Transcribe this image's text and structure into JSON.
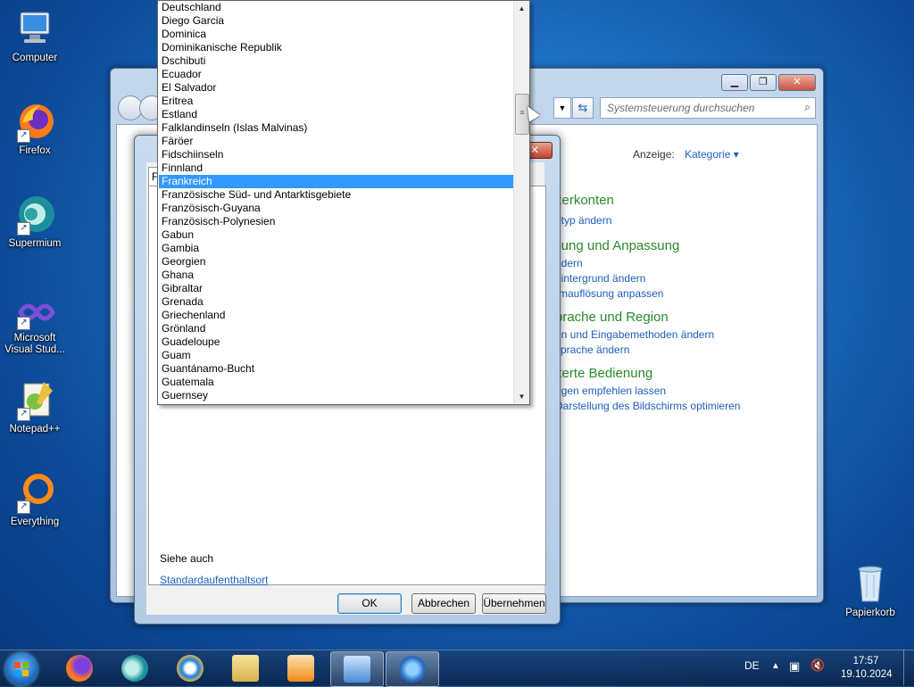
{
  "desktop": {
    "icons": [
      {
        "label": "Computer",
        "icon": "computer-icon"
      },
      {
        "label": "Firefox",
        "icon": "firefox-icon"
      },
      {
        "label": "Supermium",
        "icon": "supermium-icon"
      },
      {
        "label": "Microsoft Visual Stud...",
        "icon": "visual-studio-icon"
      },
      {
        "label": "Notepad++",
        "icon": "notepad-plus-icon"
      },
      {
        "label": "Everything",
        "icon": "everything-icon"
      },
      {
        "label": "Papierkorb",
        "icon": "recycle-bin-icon"
      }
    ]
  },
  "control_panel": {
    "search_placeholder": "Systemsteuerung durchsuchen",
    "view_label": "Anzeige:",
    "view_value": "Kategorie",
    "categories": [
      {
        "title": "zerkonten",
        "links": [
          "ptyp ändern"
        ]
      },
      {
        "title": "llung und Anpassung",
        "links": [
          "ndern",
          "hintergrund ändern",
          "rmauflösung anpassen"
        ]
      },
      {
        "title": "prache und Region",
        "links": [
          "en und Eingabemethoden ändern",
          "sprache ändern"
        ]
      },
      {
        "title": "iterte Bedienung",
        "links": [
          "ngen empfehlen lassen",
          "Darstellung des Bildschirms optimieren"
        ]
      }
    ]
  },
  "dialog": {
    "tab_label": "F",
    "see_also": "Siehe auch",
    "default_location_link": "Standardaufenthaltsort",
    "ok": "OK",
    "cancel": "Abbrechen",
    "apply": "Übernehmen"
  },
  "dropdown": {
    "items": [
      "Deutschland",
      "Diego Garcia",
      "Dominica",
      "Dominikanische Republik",
      "Dschibuti",
      "Ecuador",
      "El Salvador",
      "Eritrea",
      "Estland",
      "Falklandinseln (Islas Malvinas)",
      "Färöer",
      "Fidschiinseln",
      "Finnland",
      "Frankreich",
      "Französische Süd- und Antarktisgebiete",
      "Französisch-Guyana",
      "Französisch-Polynesien",
      "Gabun",
      "Gambia",
      "Georgien",
      "Ghana",
      "Gibraltar",
      "Grenada",
      "Griechenland",
      "Grönland",
      "Guadeloupe",
      "Guam",
      "Guantánamo-Bucht",
      "Guatemala",
      "Guernsey"
    ],
    "selected": "Frankreich"
  },
  "taskbar": {
    "language": "DE",
    "time": "17:57",
    "date": "19.10.2024",
    "pinned": [
      "firefox-icon",
      "supermium-icon",
      "internet-explorer-icon",
      "explorer-icon",
      "media-player-icon",
      "control-panel-icon",
      "region-icon"
    ]
  }
}
